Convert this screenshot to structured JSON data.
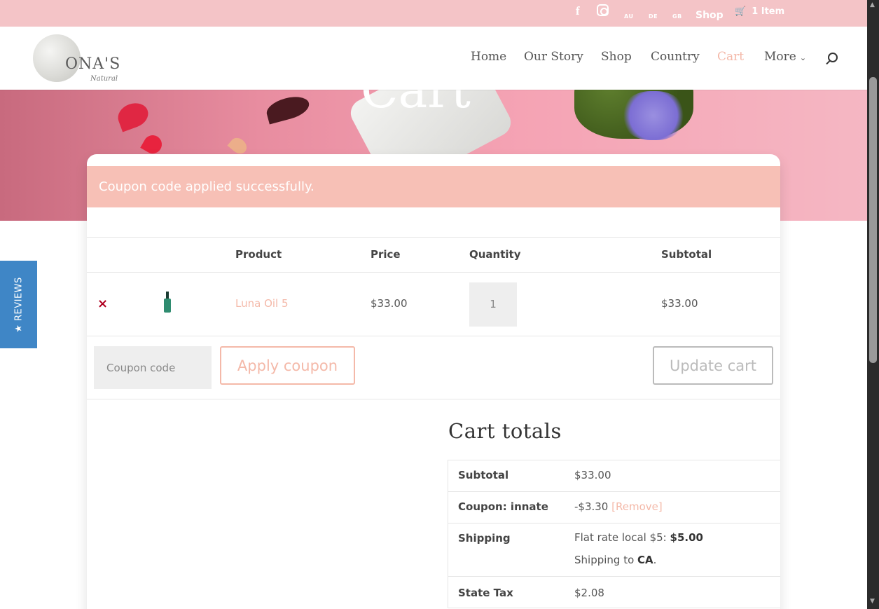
{
  "topbar": {
    "facebook_icon": "f",
    "instagram_icon": "instagram-icon",
    "flags": [
      "AU",
      "DE",
      "GB"
    ],
    "shop": "Shop",
    "cart_count": "1 Item"
  },
  "header": {
    "logo_text": "ONA'S",
    "logo_sub": "Natural",
    "nav": [
      "Home",
      "Our Story",
      "Shop",
      "Country",
      "Cart",
      "More"
    ],
    "active_nav": "Cart"
  },
  "hero": {
    "title": "Cart"
  },
  "notice": "Coupon code applied successfully.",
  "table": {
    "headers": {
      "product": "Product",
      "price": "Price",
      "quantity": "Quantity",
      "subtotal": "Subtotal"
    },
    "rows": [
      {
        "product": "Luna Oil 5",
        "price": "$33.00",
        "quantity": "1",
        "subtotal": "$33.00"
      }
    ]
  },
  "actions": {
    "coupon_placeholder": "Coupon code",
    "apply": "Apply coupon",
    "update": "Update cart"
  },
  "totals": {
    "title": "Cart totals",
    "subtotal_label": "Subtotal",
    "subtotal_value": "$33.00",
    "coupon_label": "Coupon: innate",
    "coupon_value": "-$3.30",
    "coupon_remove": "[Remove]",
    "shipping_label": "Shipping",
    "shipping_method": "Flat rate local $5: ",
    "shipping_cost": "$5.00",
    "shipping_to_prefix": "Shipping to ",
    "shipping_to_region": "CA",
    "shipping_to_suffix": ".",
    "tax_label": "State Tax",
    "tax_value": "$2.08"
  },
  "reviews_tab": "★ REVIEWS",
  "colors": {
    "accent": "#f4b9a9",
    "topbar": "#f4c4c7",
    "notice": "#f7c0b6",
    "reviews": "#3f86c6"
  }
}
